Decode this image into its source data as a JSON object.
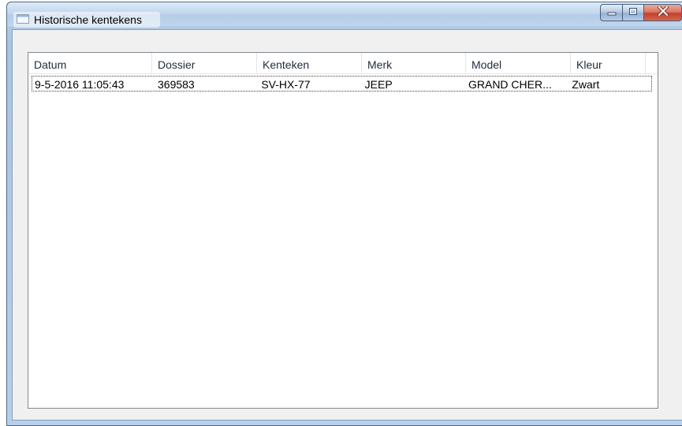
{
  "window": {
    "title": "Historische kentekens",
    "accent_color": "#b9d1ea",
    "close_color": "#c5412b"
  },
  "caption_buttons": {
    "minimize_icon": "minimize-icon",
    "maximize_icon": "maximize-icon",
    "close_icon": "close-icon"
  },
  "table": {
    "columns": [
      "Datum",
      "Dossier",
      "Kenteken",
      "Merk",
      "Model",
      "Kleur"
    ],
    "rows": [
      {
        "datum": "9-5-2016 11:05:43",
        "dossier": "369583",
        "kenteken": "SV-HX-77",
        "merk": "JEEP",
        "model": "GRAND CHER...",
        "kleur": "Zwart"
      }
    ]
  }
}
